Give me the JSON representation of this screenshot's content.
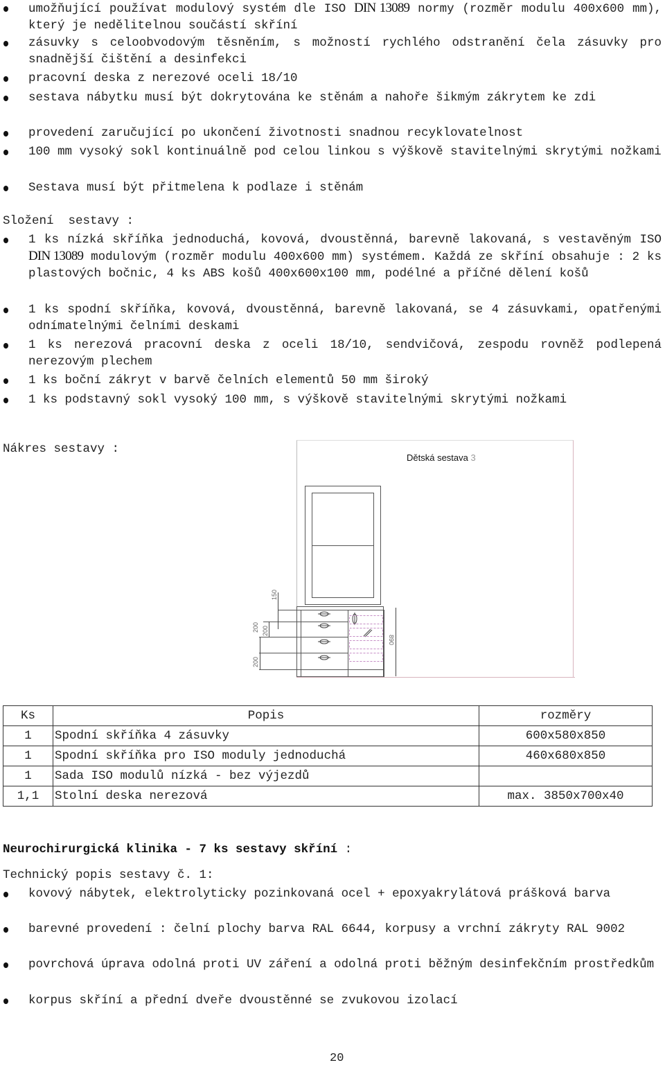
{
  "intro_bullets": [
    {
      "pre": "umožňující používat modulový systém dle ISO ",
      "norm": "DIN 13089",
      "post": " normy (rozměr modulu 400x600 mm), který je nedělitelnou součástí skříní"
    },
    {
      "text": "zásuvky s celoobvodovým těsněním, s možností rychlého odstranění čela zásuvky pro snadnější čištění a desinfekci"
    },
    {
      "text": "pracovní deska z nerezové oceli 18/10"
    },
    {
      "text": "sestava nábytku musí být dokrytována ke stěnám a nahoře šikmým zákrytem ke zdi"
    },
    {
      "text": "provedení zaručující po ukončení životnosti snadnou recyklovatelnost"
    },
    {
      "text": "100 mm vysoký sokl kontinuálně pod celou linkou s výškově stavitelnými skrytými nožkami"
    },
    {
      "text": "Sestava musí být přitmelena k podlaze i stěnám"
    }
  ],
  "composition": {
    "heading": "Složení  sestavy :",
    "items": [
      {
        "pre": "1 ks nízká skříňka jednoduchá, kovová, dvoustěnná, barevně lakovaná, s vestavěným ISO ",
        "norm": "DIN 13089",
        "post": " modulovým (rozměr modulu 400x600 mm) systémem. Každá ze skříní obsahuje : 2 ks plastových bočnic, 4 ks ABS košů 400x600x100 mm, podélné a příčné dělení košů"
      },
      {
        "text": "1 ks spodní skříňka, kovová, dvoustěnná, barevně lakovaná, se 4 zásuvkami, opatřenými  odnímatelnými čelními deskami"
      },
      {
        "text": "1 ks nerezová pracovní deska z oceli 18/10, sendvičová, zespodu rovněž podlepená nerezovým plechem"
      },
      {
        "text": "1 ks boční zákryt v barvě čelních elementů 50 mm široký"
      },
      {
        "text": "1 ks podstavný sokl vysoký 100 mm, s výškově stavitelnými skrytými nožkami"
      }
    ]
  },
  "drawing": {
    "heading": "Nákres sestavy :",
    "title": "Dětská sestava",
    "title_number": "3",
    "dimensions": {
      "top_gap": "150",
      "drawer_1": "200",
      "drawer_2": "200",
      "drawer_3": "200",
      "total_height": "890"
    }
  },
  "table": {
    "headers": [
      "Ks",
      "Popis",
      "rozměry"
    ],
    "rows": [
      [
        "1",
        "Spodní skříňka 4 zásuvky",
        "600x580x850"
      ],
      [
        "1",
        "Spodní skříňka pro ISO moduly jednoduchá",
        "460x680x850"
      ],
      [
        "1",
        "Sada ISO modulů nízká - bez výjezdů",
        ""
      ],
      [
        "1,1",
        "Stolní deska nerezová",
        "max. 3850x700x40"
      ]
    ]
  },
  "section2": {
    "title": "Neurochirurgická klinika - 7 ks sestavy skříní",
    "title_suffix": " :",
    "subheading": "Technický popis sestavy č. 1:",
    "items": [
      "kovový nábytek, elektrolyticky pozinkovaná ocel + epoxyakrylátová prášková barva",
      "barevné provedení : čelní plochy barva RAL 6644, korpusy a vrchní zákryty RAL 9002",
      "povrchová úprava odolná proti UV záření a odolná proti běžným desinfekčním prostředkům",
      "korpus skříní a přední dveře dvoustěnné se zvukovou izolací"
    ]
  },
  "page_number": "20"
}
